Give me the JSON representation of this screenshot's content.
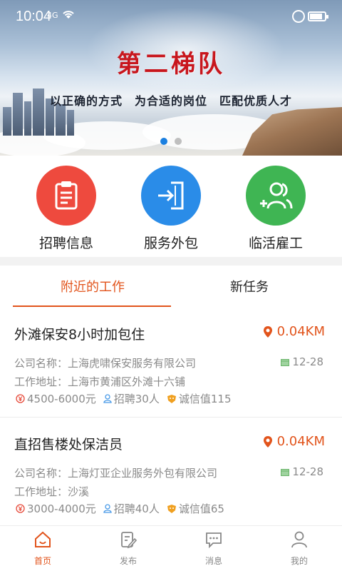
{
  "status_bar": {
    "time": "10:04",
    "signal": "4G",
    "battery_level": 0.85
  },
  "banner": {
    "title": "第二梯队",
    "slogan": "以正确的方式　为合适的岗位　匹配优质人才",
    "slide_count": 2,
    "active_slide": 1
  },
  "categories": [
    {
      "label": "招聘信息",
      "icon": "clipboard-icon",
      "color": "#ee4a3e"
    },
    {
      "label": "服务外包",
      "icon": "door-enter-icon",
      "color": "#2a8ce8"
    },
    {
      "label": "临活雇工",
      "icon": "add-user-icon",
      "color": "#3fb553"
    }
  ],
  "tabs": [
    {
      "label": "附近的工作",
      "active": true
    },
    {
      "label": "新任务",
      "active": false
    }
  ],
  "jobs": [
    {
      "title": "外滩保安8小时加包住",
      "distance": "0.04KM",
      "company": "公司名称：上海虎啸保安服务有限公司",
      "date": "12-28",
      "address": "工作地址：上海市黄浦区外滩十六铺",
      "salary": "4500-6000元",
      "recruit": "招聘30人",
      "credit": "诚信值115"
    },
    {
      "title": "直招售楼处保洁员",
      "distance": "0.04KM",
      "company": "公司名称：上海灯亚企业服务外包有限公司",
      "date": "12-28",
      "address": "工作地址：沙溪",
      "salary": "3000-4000元",
      "recruit": "招聘40人",
      "credit": "诚信值65"
    }
  ],
  "bottom_nav": [
    {
      "label": "首页",
      "icon": "home-icon",
      "active": true
    },
    {
      "label": "发布",
      "icon": "edit-icon",
      "active": false
    },
    {
      "label": "消息",
      "icon": "message-icon",
      "active": false
    },
    {
      "label": "我的",
      "icon": "user-icon",
      "active": false
    }
  ],
  "colors": {
    "accent": "#e2541c",
    "slide_dot_active": "#1a7fe0",
    "banner_title": "#c8161d"
  }
}
